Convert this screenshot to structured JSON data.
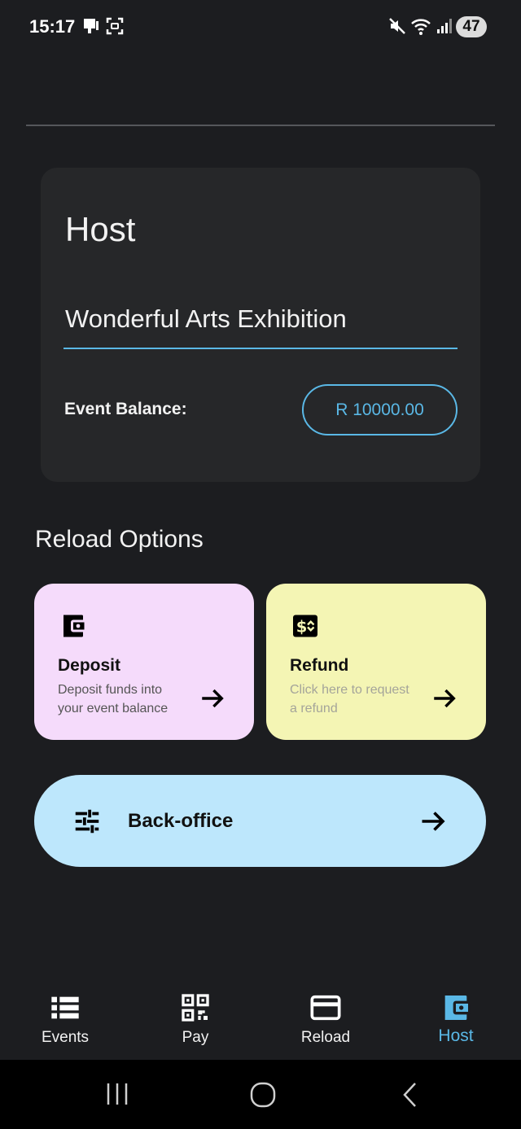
{
  "status_bar": {
    "time": "15:17",
    "battery": "47"
  },
  "host_card": {
    "title": "Host",
    "event_name": "Wonderful Arts Exhibition",
    "balance_label": "Event Balance:",
    "balance_value": "R 10000.00"
  },
  "reload_options": {
    "heading": "Reload Options",
    "deposit": {
      "title": "Deposit",
      "description": "Deposit funds into your event balance",
      "icon": "wallet-icon"
    },
    "refund": {
      "title": "Refund",
      "description": "Click here to request a refund",
      "icon": "money-icon"
    }
  },
  "back_office": {
    "label": "Back-office",
    "icon": "tune-icon"
  },
  "bottom_nav": {
    "items": [
      {
        "label": "Events",
        "icon": "list-icon"
      },
      {
        "label": "Pay",
        "icon": "qr-code-icon"
      },
      {
        "label": "Reload",
        "icon": "credit-card-icon"
      },
      {
        "label": "Host",
        "icon": "wallet-icon"
      }
    ],
    "active": "Host"
  },
  "colors": {
    "background": "#1c1d20",
    "card": "#262729",
    "accent": "#5ab8e6",
    "deposit_card": "#f5dbfb",
    "refund_card": "#f4f5b4",
    "backoffice_button": "#bde7fc"
  }
}
